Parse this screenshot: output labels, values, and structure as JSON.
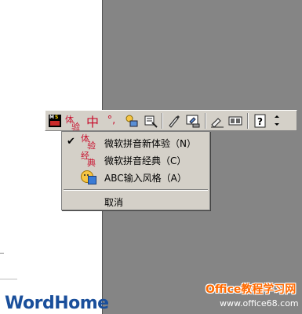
{
  "toolbar": {
    "buttons": [
      {
        "name": "ms-ime-icon",
        "text": "MS"
      },
      {
        "name": "pinyin-mode-icon",
        "text": "体验"
      },
      {
        "name": "chinese-mode-button",
        "text": "中"
      },
      {
        "name": "punctuation-mode-button",
        "text": "°,"
      },
      {
        "name": "soft-keyboard-icon",
        "text": ""
      },
      {
        "name": "tool-edit-icon",
        "text": ""
      },
      {
        "name": "handwriting-icon",
        "text": ""
      },
      {
        "name": "pad-icon",
        "text": ""
      },
      {
        "name": "pen-icon",
        "text": ""
      },
      {
        "name": "properties-icon",
        "text": ""
      },
      {
        "name": "help-icon",
        "text": "?"
      },
      {
        "name": "options-arrow-icon",
        "text": ""
      }
    ]
  },
  "menu": {
    "items": [
      {
        "label": "微软拼音新体验（N）",
        "checked": true,
        "icon": "pinyin-new-icon"
      },
      {
        "label": "微软拼音经典（C）",
        "checked": false,
        "icon": "pinyin-classic-icon"
      },
      {
        "label": "ABC输入风格（A）",
        "checked": false,
        "icon": "abc-style-icon"
      },
      {
        "label": "取消",
        "checked": false,
        "icon": ""
      }
    ]
  },
  "footer": {
    "logo": "WordHome",
    "watermark": "Office教程学习网",
    "watermark_url": "www.office68.com"
  }
}
